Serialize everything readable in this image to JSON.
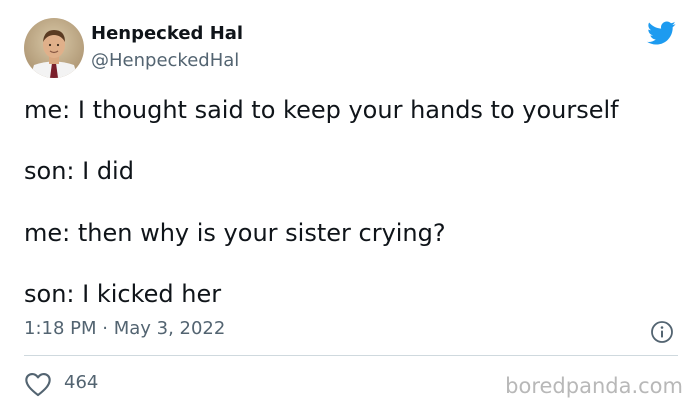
{
  "author": {
    "display_name": "Henpecked Hal",
    "handle": "@HenpeckedHal",
    "avatar_icon": "user-avatar-photo"
  },
  "brand": {
    "icon": "twitter-bird-icon",
    "color": "#1d9bf0"
  },
  "tweet": {
    "lines": [
      "me: I thought said to keep your hands to yourself",
      "son: I did",
      "me: then why is your sister crying?",
      "son: I kicked her"
    ]
  },
  "meta": {
    "timestamp": "1:18 PM · May 3, 2022"
  },
  "engagement": {
    "likes": "464"
  },
  "watermark": "boredpanda.com"
}
